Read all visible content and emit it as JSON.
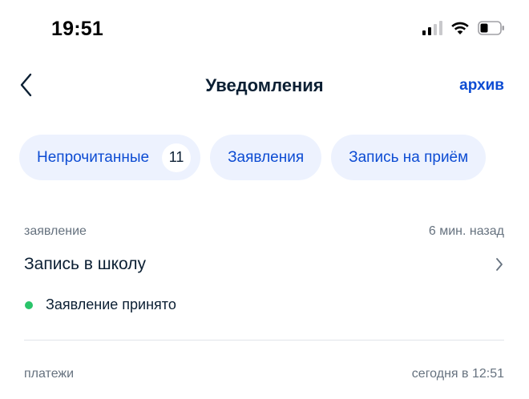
{
  "status_bar": {
    "time": "19:51",
    "icons": [
      "signal-icon",
      "wifi-icon",
      "battery-icon"
    ]
  },
  "header": {
    "back_icon": "chevron-left-icon",
    "title": "Уведомления",
    "archive_label": "архив"
  },
  "filters": [
    {
      "label": "Непрочитанные",
      "count": "11"
    },
    {
      "label": "Заявления"
    },
    {
      "label": "Запись на приём"
    }
  ],
  "notifications": [
    {
      "category": "заявление",
      "time": "6 мин. назад",
      "title": "Запись в школу",
      "status": "Заявление принято",
      "status_color": "#2ac46a"
    },
    {
      "category": "платежи",
      "time": "сегодня в 12:51"
    }
  ],
  "colors": {
    "accent": "#0d4cd3",
    "chip_bg": "#edf2fe",
    "text": "#0b1f33",
    "muted": "#66727f",
    "success": "#2ac46a"
  }
}
